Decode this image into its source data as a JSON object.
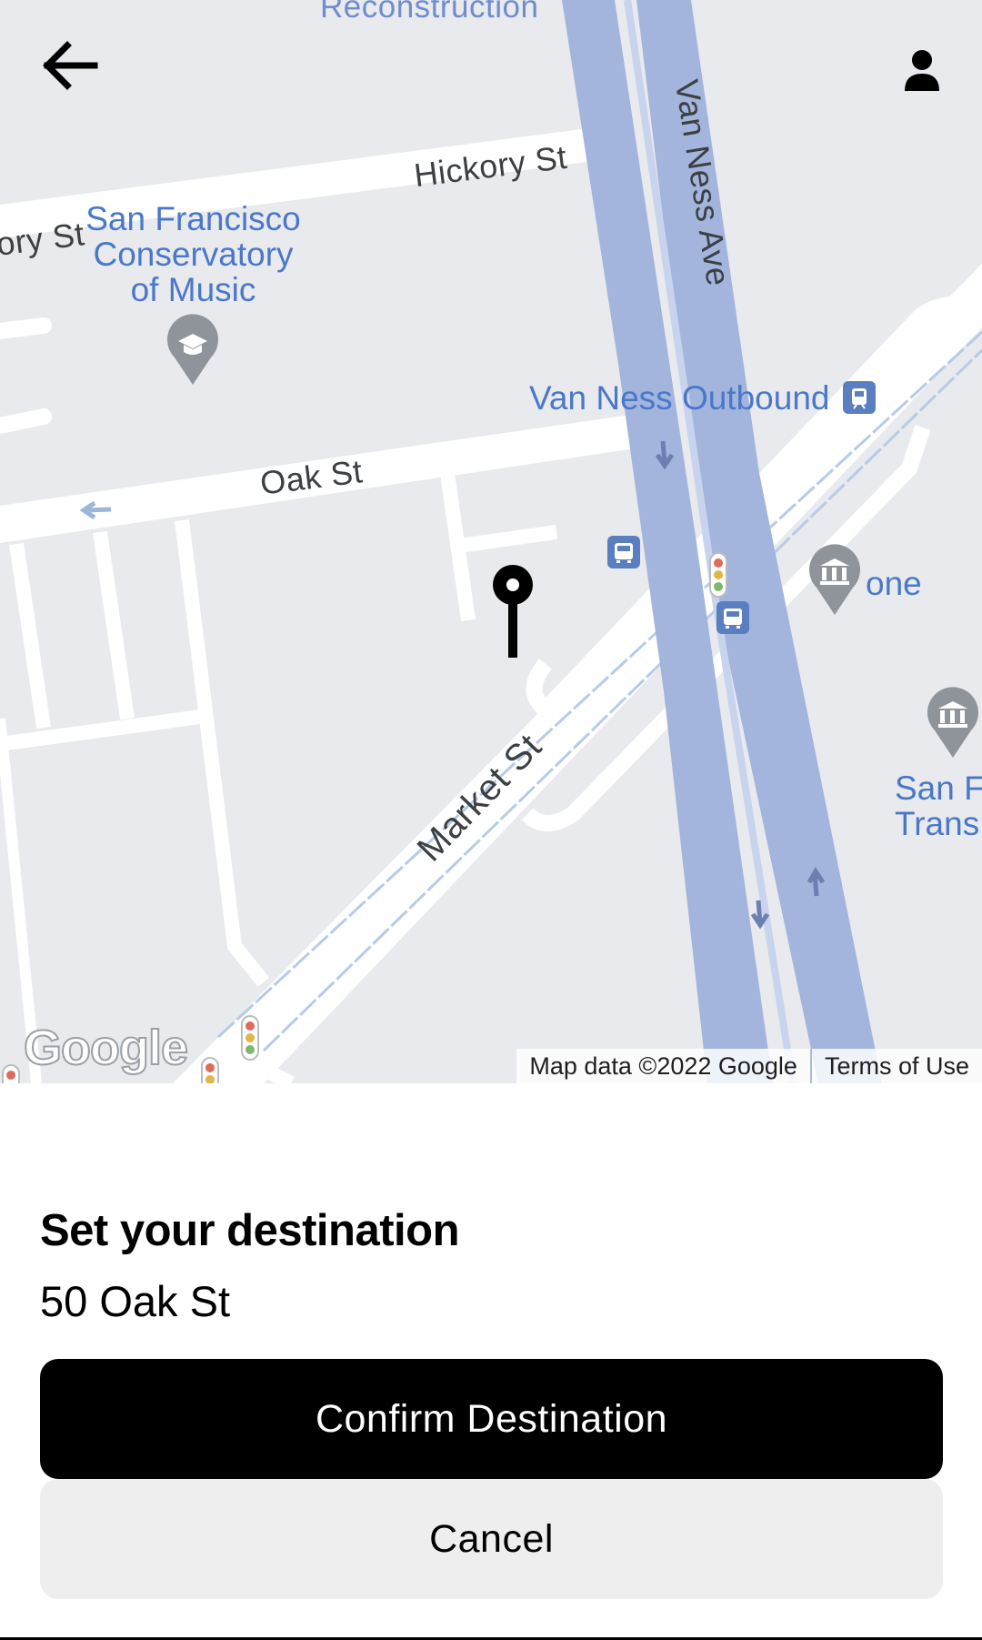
{
  "map": {
    "road_labels": {
      "hickory_st": "Hickory St",
      "hickory_st_left": "ory St",
      "oak_st": "Oak St",
      "van_ness_ave": "Van Ness Ave",
      "market_st": "Market St",
      "top_cut": "Reconstruction"
    },
    "poi_labels": {
      "conservatory": "San Francisco Conservatory of Music",
      "van_ness_outbound": "Van Ness Outbound",
      "one": "one",
      "sf_trans": "San F\nTrans"
    },
    "attribution": {
      "logo": "Google",
      "map_data": "Map data ©2022 Google",
      "terms": "Terms of Use"
    },
    "icons": {
      "back": "arrow-left-icon",
      "profile": "person-icon",
      "pin": "destination-pin-icon",
      "school": "graduation-cap-icon",
      "transit": "tram-icon",
      "bus": "bus-icon",
      "museum": "museum-icon",
      "traffic": "traffic-light-icon"
    },
    "colors": {
      "land": "#e8eaed",
      "road": "#ffffff",
      "highway": "#a3b4dd",
      "poi_text": "#4a78c9",
      "rail": "#b7cbe8"
    }
  },
  "sheet": {
    "title": "Set your destination",
    "address": "50 Oak St",
    "confirm_label": "Confirm Destination",
    "cancel_label": "Cancel"
  }
}
